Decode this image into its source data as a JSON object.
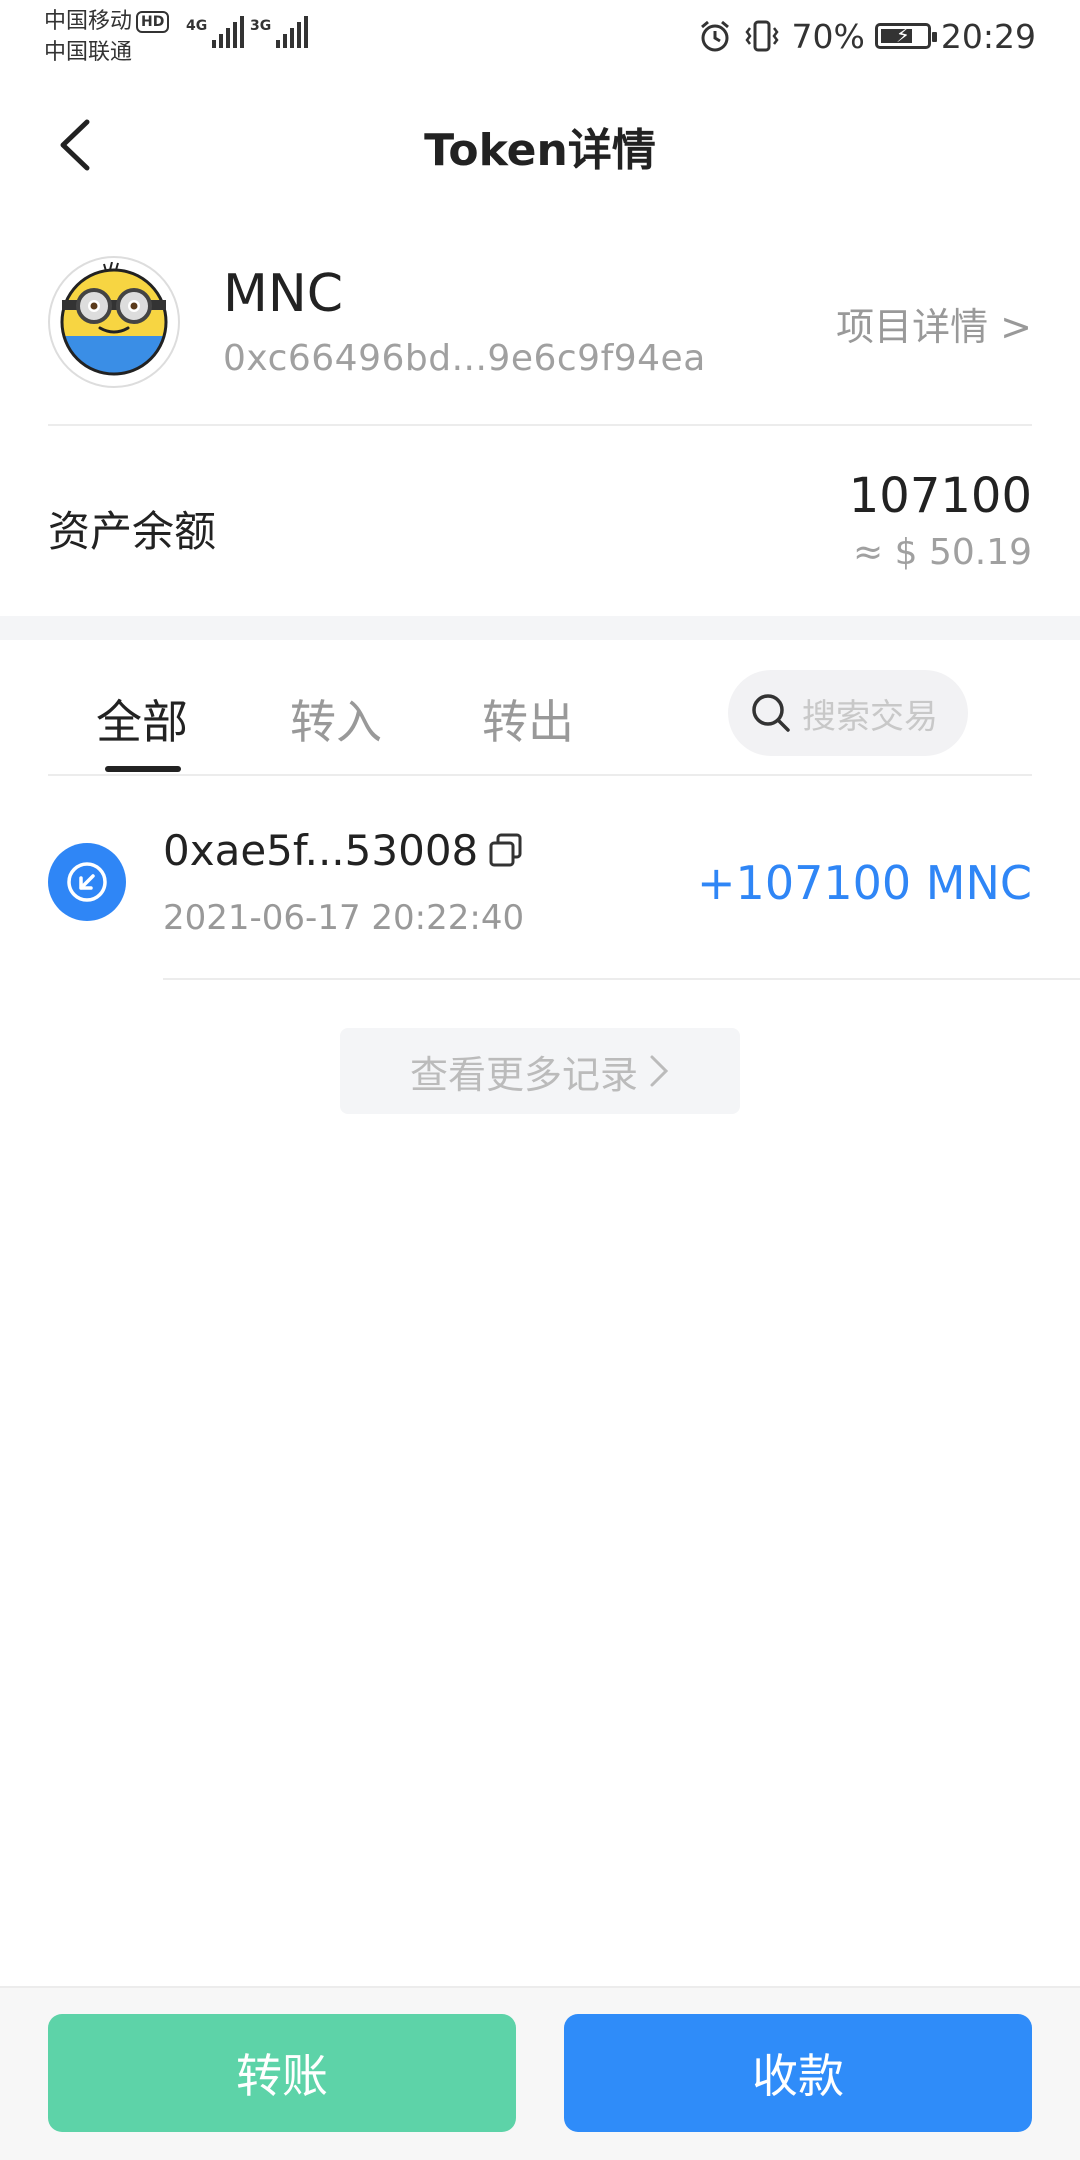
{
  "status_bar": {
    "carrier_1": "中国移动",
    "carrier_1_badge": "HD",
    "carrier_2": "中国联通",
    "network_1": "4G",
    "network_2": "3G",
    "battery_percent": "70%",
    "battery_level": 0.7,
    "time": "20:29",
    "icons": [
      "alarm-icon",
      "vibrate-icon",
      "battery-charging-icon"
    ]
  },
  "header": {
    "title": "Token详情"
  },
  "token": {
    "name": "MNC",
    "address": "0xc66496bd...9e6c9f94ea",
    "project_link": "项目详情 >"
  },
  "balance": {
    "label": "资产余额",
    "amount": "107100",
    "fiat": "≈ $ 50.19"
  },
  "tabs": [
    {
      "label": "全部",
      "active": true
    },
    {
      "label": "转入",
      "active": false
    },
    {
      "label": "转出",
      "active": false
    }
  ],
  "search": {
    "placeholder": "搜索交易"
  },
  "transactions": [
    {
      "hash": "0xae5f...53008",
      "time": "2021-06-17 20:22:40",
      "amount": "+107100 MNC",
      "direction": "in"
    }
  ],
  "more_records": "查看更多记录",
  "actions": {
    "transfer": "转账",
    "receive": "收款"
  },
  "colors": {
    "accent": "#2f8cf9",
    "income": "#2f86f6",
    "transfer_button": "#5dd3a8"
  }
}
